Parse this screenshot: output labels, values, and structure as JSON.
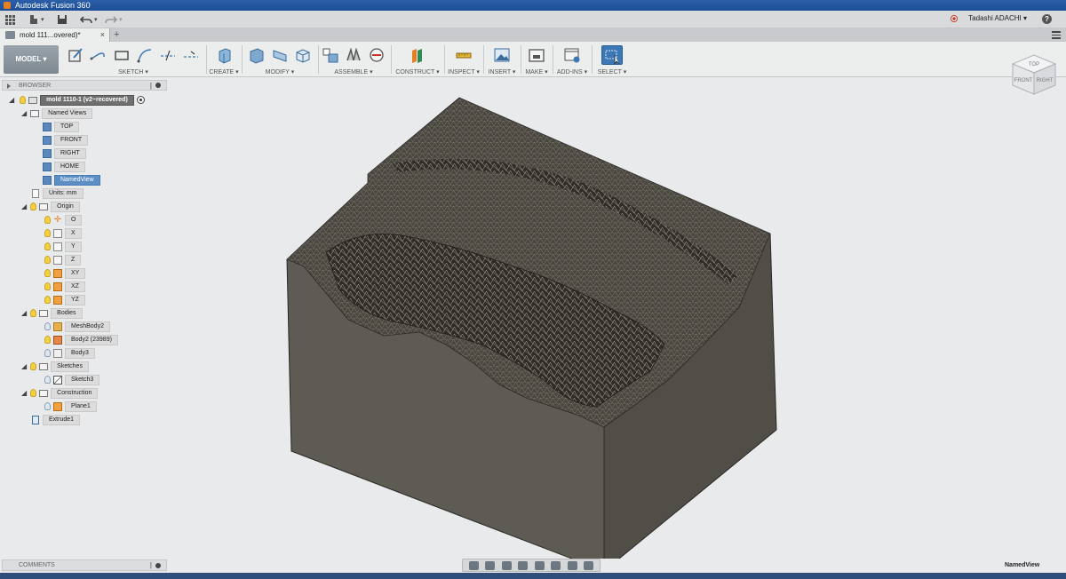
{
  "window": {
    "title": "Autodesk Fusion 360"
  },
  "quick_access": {
    "user": "Tadashi ADACHI ▾",
    "help": "?"
  },
  "document_tab": {
    "label": "mold 111...overed)*",
    "close": "×",
    "new_tab": "+"
  },
  "ribbon": {
    "workspace": "MODEL ▾",
    "groups": [
      {
        "label": "SKETCH ▾"
      },
      {
        "label": "CREATE ▾"
      },
      {
        "label": "MODIFY ▾"
      },
      {
        "label": "ASSEMBLE ▾"
      },
      {
        "label": "CONSTRUCT ▾"
      },
      {
        "label": "INSPECT ▾"
      },
      {
        "label": "INSERT ▾"
      },
      {
        "label": "MAKE ▾"
      },
      {
        "label": "ADD-INS ▾"
      },
      {
        "label": "SELECT ▾"
      }
    ]
  },
  "viewcube": {
    "top": "TOP",
    "front": "FRONT",
    "right": "RIGHT"
  },
  "browser": {
    "header": "BROWSER",
    "root": "mold 1110-1 (v2~recovered)",
    "named_views": {
      "label": "Named Views",
      "items": [
        "TOP",
        "FRONT",
        "RIGHT",
        "HOME",
        "NamedView"
      ]
    },
    "units": "Units: mm",
    "origin": {
      "label": "Origin",
      "items": [
        "O",
        "X",
        "Y",
        "Z",
        "XY",
        "XZ",
        "YZ"
      ]
    },
    "bodies": {
      "label": "Bodies",
      "items": [
        "MeshBody2",
        "Body2 (23989)",
        "Body3"
      ]
    },
    "sketches": {
      "label": "Sketches",
      "items": [
        "Sketch3"
      ]
    },
    "construction": {
      "label": "Construction",
      "items": [
        "Plane1"
      ]
    },
    "timeline_item": "Extrude1"
  },
  "comments": {
    "header": "COMMENTS"
  },
  "statusbar": {
    "named_view": "NamedView"
  },
  "colors": {
    "selection_blue": "#5b8ec4",
    "title_blue": "#2b5fa8",
    "model_gray": "#5a5953"
  }
}
